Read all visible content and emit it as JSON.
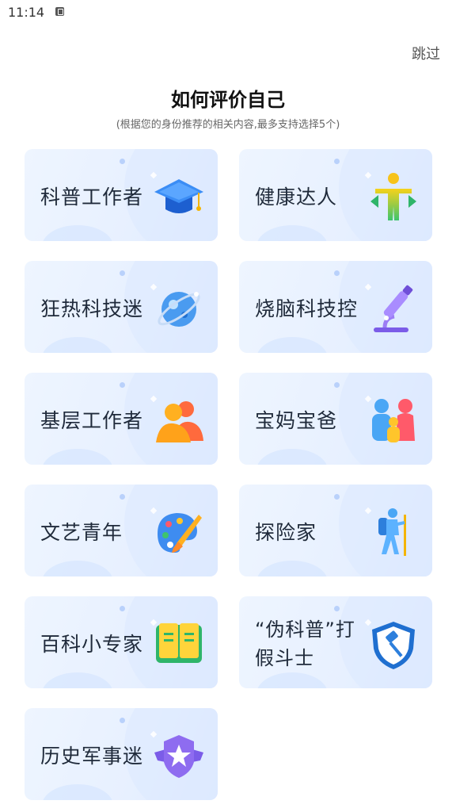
{
  "status": {
    "time": "11:14"
  },
  "header": {
    "skip_label": "跳过"
  },
  "page": {
    "title": "如何评价自己",
    "subtitle": "(根据您的身份推荐的相关内容,最多支持选择5个)"
  },
  "options": [
    {
      "label": "科普工作者",
      "icon": "graduation-cap-icon"
    },
    {
      "label": "健康达人",
      "icon": "fitness-person-icon"
    },
    {
      "label": "狂热科技迷",
      "icon": "planet-icon"
    },
    {
      "label": "烧脑科技控",
      "icon": "microscope-icon"
    },
    {
      "label": "基层工作者",
      "icon": "workers-group-icon"
    },
    {
      "label": "宝妈宝爸",
      "icon": "family-icon"
    },
    {
      "label": "文艺青年",
      "icon": "paint-palette-icon"
    },
    {
      "label": "探险家",
      "icon": "hiker-icon"
    },
    {
      "label": "百科小专家",
      "icon": "open-book-icon"
    },
    {
      "label": "“伪科普”打假斗士",
      "icon": "judge-shield-icon"
    },
    {
      "label": "历史军事迷",
      "icon": "military-star-badge-icon"
    }
  ]
}
